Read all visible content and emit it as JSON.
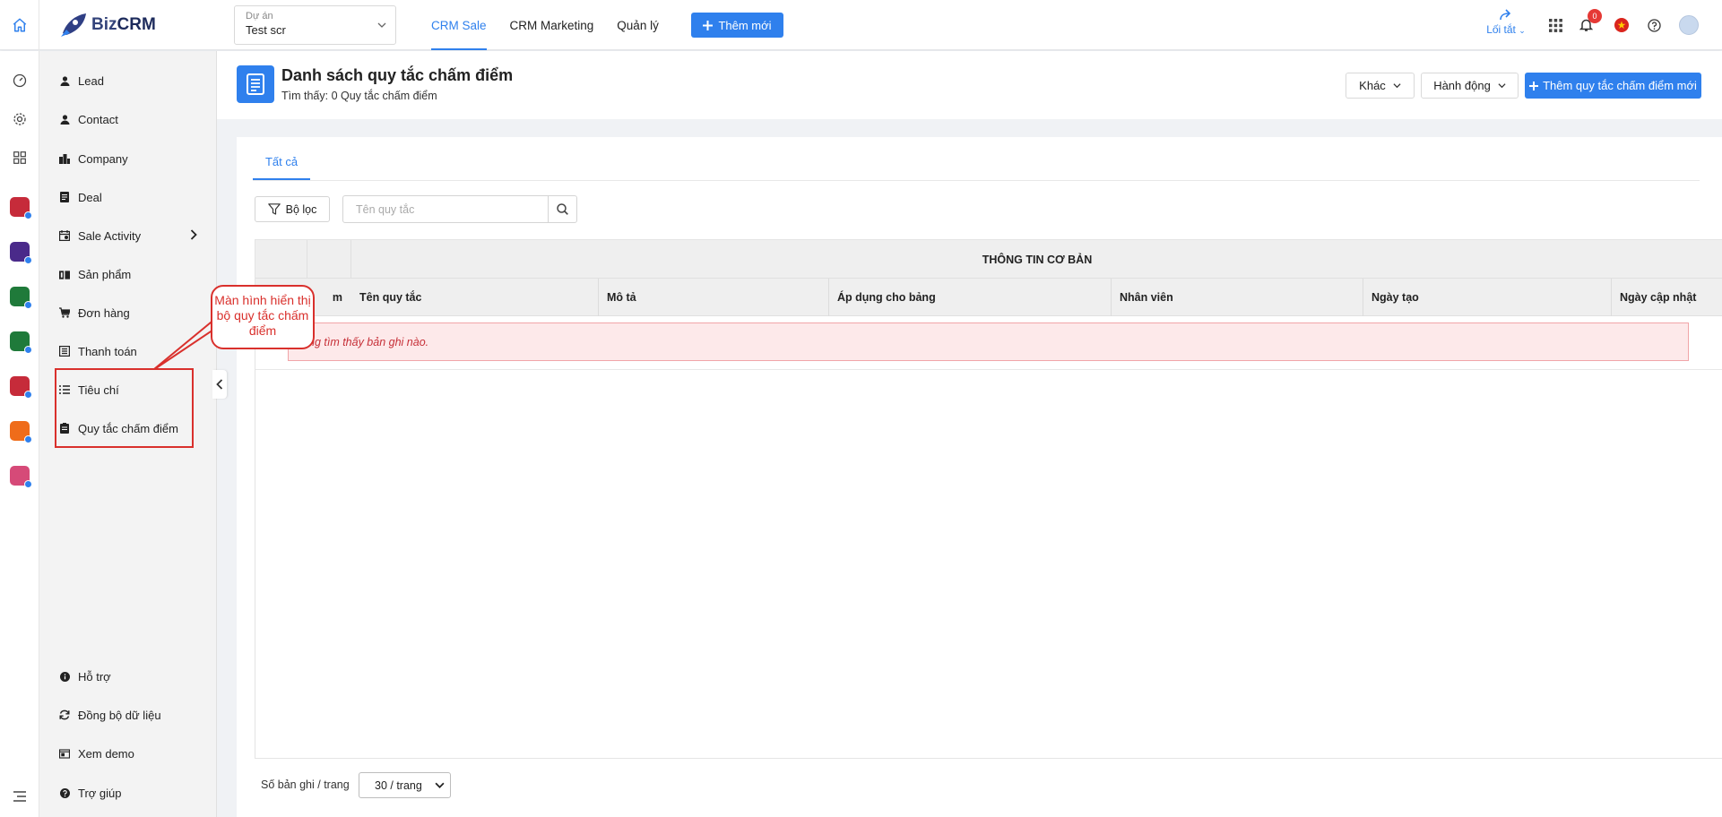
{
  "header": {
    "logo_biz": "Biz",
    "logo_crm": "CRM",
    "project_label": "Dự án",
    "project_value": "Test scr",
    "nav": [
      {
        "label": "CRM Sale",
        "active": true
      },
      {
        "label": "CRM Marketing",
        "active": false
      },
      {
        "label": "Quản lý",
        "active": false
      }
    ],
    "new_button": "Thêm mới",
    "shortcut_label": "Lối tắt",
    "notification_count": "0"
  },
  "sidebar": {
    "items": [
      {
        "label": "Lead",
        "icon": "user-icon"
      },
      {
        "label": "Contact",
        "icon": "user-icon"
      },
      {
        "label": "Company",
        "icon": "building-icon"
      },
      {
        "label": "Deal",
        "icon": "document-icon"
      },
      {
        "label": "Sale Activity",
        "icon": "calendar-icon"
      },
      {
        "label": "Sản phẩm",
        "icon": "book-icon"
      },
      {
        "label": "Đơn hàng",
        "icon": "cart-icon"
      },
      {
        "label": "Thanh toán",
        "icon": "receipt-icon"
      },
      {
        "label": "Tiêu chí",
        "icon": "list-icon"
      },
      {
        "label": "Quy tắc chấm điểm",
        "icon": "clipboard-icon"
      }
    ],
    "bottom_items": [
      {
        "label": "Hỗ trợ",
        "icon": "info-icon"
      },
      {
        "label": "Đồng bộ dữ liệu",
        "icon": "sync-icon"
      },
      {
        "label": "Xem demo",
        "icon": "video-icon"
      },
      {
        "label": "Trợ giúp",
        "icon": "help-icon"
      }
    ]
  },
  "annotation": {
    "callout_text": "Màn hình hiển thị bộ quy tắc chấm điểm"
  },
  "page": {
    "title": "Danh sách quy tắc chấm điểm",
    "subtitle": "Tìm thấy: 0 Quy tắc chấm điểm",
    "other_button": "Khác",
    "action_button": "Hành động",
    "add_button": "Thêm quy tắc chấm điểm mới",
    "tab_all": "Tất cả",
    "filter_button": "Bộ lọc",
    "search_placeholder": "Tên quy tắc"
  },
  "table": {
    "group_header": "THÔNG TIN CƠ BẢN",
    "columns": [
      {
        "label": "Tên quy tắc"
      },
      {
        "label": "Mô tả"
      },
      {
        "label": "Áp dụng cho bảng"
      },
      {
        "label": "Nhân viên"
      },
      {
        "label": "Ngày tạo"
      },
      {
        "label": "Ngày cập nhật"
      }
    ],
    "hidden_col_fragment": "m",
    "empty_message": "ng tìm thấy bản ghi nào."
  },
  "pagination": {
    "label": "Số bản ghi / trang",
    "page_size": "30 / trang"
  },
  "colors": {
    "primary": "#2f80ed",
    "annotation": "#d9302c",
    "empty_bg": "#fde9ea",
    "empty_text": "#c62f37"
  }
}
